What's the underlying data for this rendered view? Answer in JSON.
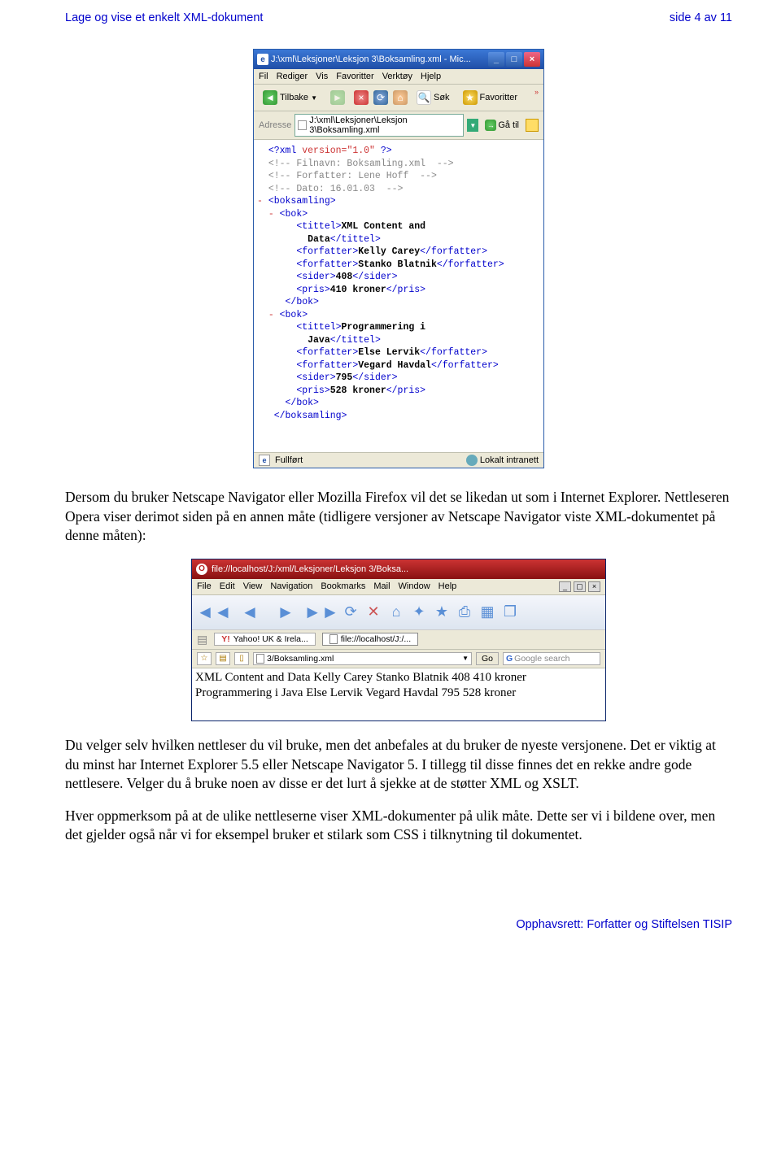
{
  "header": {
    "left": "Lage og vise et enkelt XML-dokument",
    "right": "side 4 av 11"
  },
  "ie": {
    "title": "J:\\xml\\Leksjoner\\Leksjon 3\\Boksamling.xml - Mic...",
    "menu": [
      "Fil",
      "Rediger",
      "Vis",
      "Favoritter",
      "Verktøy",
      "Hjelp"
    ],
    "toolbar": {
      "back": "Tilbake",
      "search": "Søk",
      "fav": "Favoritter"
    },
    "address": {
      "label": "Adresse",
      "value": "J:\\xml\\Leksjoner\\Leksjon 3\\Boksamling.xml",
      "go": "Gå til"
    },
    "xml": {
      "decl_open": "<?xml ",
      "decl_attr": "version=\"1.0\" ",
      "decl_close": "?>",
      "c1": "<!-- Filnavn: Boksamling.xml  -->",
      "c2": "<!-- Forfatter: Lene Hoff  -->",
      "c3": "<!-- Dato: 16.01.03  -->",
      "boksamling_o": "<boksamling>",
      "boksamling_c": "</boksamling>",
      "bok_o": "<bok>",
      "bok_c": "</bok>",
      "dash": "- ",
      "tittel_o": "<tittel>",
      "tittel_c": "</tittel>",
      "forfatter_o": "<forfatter>",
      "forfatter_c": "</forfatter>",
      "sider_o": "<sider>",
      "sider_c": "</sider>",
      "pris_o": "<pris>",
      "pris_c": "</pris>",
      "b1": {
        "tittel1": "XML Content and",
        "tittel2": "Data",
        "f1": "Kelly Carey",
        "f2": "Stanko Blatnik",
        "sider": "408",
        "pris": "410 kroner"
      },
      "b2": {
        "tittel1": "Programmering i",
        "tittel2": "Java",
        "f1": "Else Lervik",
        "f2": "Vegard Havdal",
        "sider": "795",
        "pris": "528 kroner"
      }
    },
    "status": {
      "done": "Fullført",
      "zone": "Lokalt intranett"
    }
  },
  "para1": "Dersom du bruker Netscape Navigator eller Mozilla Firefox vil det se likedan ut som i Internet Explorer. Nettleseren Opera viser derimot siden på en annen måte (tidligere versjoner av Netscape Navigator viste XML-dokumentet på denne måten):",
  "opera": {
    "title": "file://localhost/J:/xml/Leksjoner/Leksjon 3/Boksa...",
    "menu": [
      "File",
      "Edit",
      "View",
      "Navigation",
      "Bookmarks",
      "Mail",
      "Window",
      "Help"
    ],
    "tabs": {
      "yahoo": "Yahoo! UK & Irela...",
      "file": "file://localhost/J:/..."
    },
    "address": {
      "value": "3/Boksamling.xml",
      "go": "Go",
      "search": "Google search"
    },
    "content": "XML Content and Data Kelly Carey Stanko Blatnik 408 410 kroner Programmering i Java Else Lervik Vegard Havdal 795 528 kroner"
  },
  "para2": "Du velger selv hvilken nettleser du vil bruke, men det anbefales at du bruker de nyeste versjonene. Det er viktig at du minst har Internet Explorer 5.5 eller Netscape Navigator 5. I tillegg til disse finnes det en rekke andre gode nettlesere. Velger du å bruke noen av disse er det lurt å sjekke at de støtter XML og XSLT.",
  "para3": "Hver oppmerksom på at de ulike nettleserne viser XML-dokumenter på ulik måte. Dette ser vi i bildene over, men det gjelder også når vi for eksempel bruker et stilark som CSS i tilknytning til dokumentet.",
  "footer": "Opphavsrett:  Forfatter og Stiftelsen TISIP"
}
